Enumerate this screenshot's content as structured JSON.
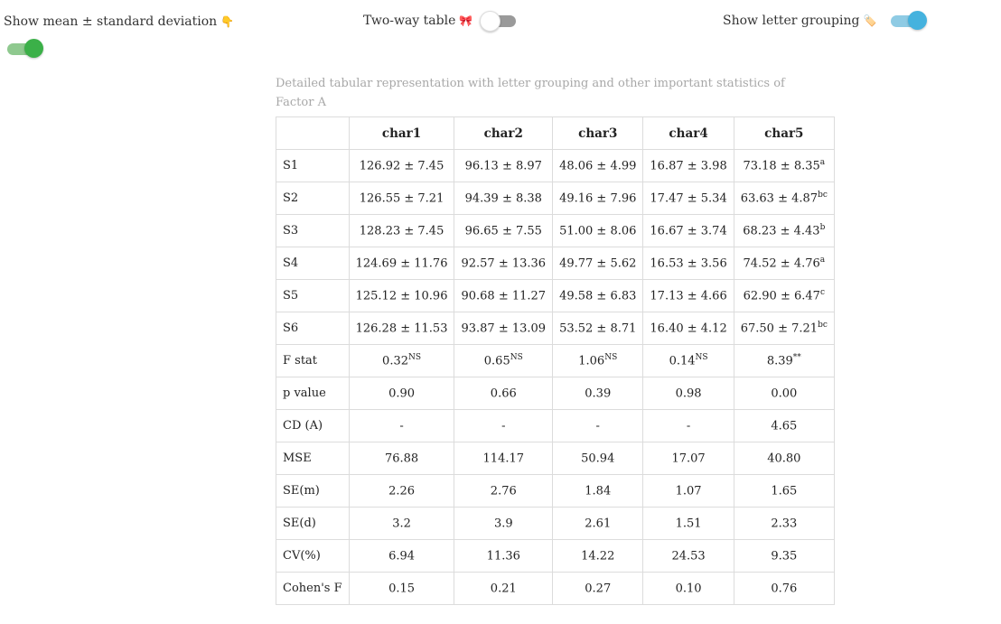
{
  "toggles": {
    "mean_sd": {
      "label": "Show mean ± standard deviation",
      "emoji": "👇",
      "state": "on",
      "color": "#3bb048"
    },
    "two_way": {
      "label": "Two-way table",
      "emoji": "🎀",
      "state": "off"
    },
    "letter_grouping": {
      "label": "Show letter grouping",
      "emoji": "🏷️",
      "state": "on",
      "color": "#45b2de"
    }
  },
  "caption": "Detailed tabular representation with letter grouping and other important statistics of Factor A",
  "table": {
    "headers": [
      "",
      "char1",
      "char2",
      "char3",
      "char4",
      "char5"
    ],
    "rows": [
      {
        "label": "S1",
        "cells": [
          [
            "126.92 ± 7.45",
            ""
          ],
          [
            "96.13 ± 8.97",
            ""
          ],
          [
            "48.06 ± 4.99",
            ""
          ],
          [
            "16.87 ± 3.98",
            ""
          ],
          [
            "73.18 ± 8.35",
            "a"
          ]
        ]
      },
      {
        "label": "S2",
        "cells": [
          [
            "126.55 ± 7.21",
            ""
          ],
          [
            "94.39 ± 8.38",
            ""
          ],
          [
            "49.16 ± 7.96",
            ""
          ],
          [
            "17.47 ± 5.34",
            ""
          ],
          [
            "63.63 ± 4.87",
            "bc"
          ]
        ]
      },
      {
        "label": "S3",
        "cells": [
          [
            "128.23 ± 7.45",
            ""
          ],
          [
            "96.65 ± 7.55",
            ""
          ],
          [
            "51.00 ± 8.06",
            ""
          ],
          [
            "16.67 ± 3.74",
            ""
          ],
          [
            "68.23 ± 4.43",
            "b"
          ]
        ]
      },
      {
        "label": "S4",
        "cells": [
          [
            "124.69 ± 11.76",
            ""
          ],
          [
            "92.57 ± 13.36",
            ""
          ],
          [
            "49.77 ± 5.62",
            ""
          ],
          [
            "16.53 ± 3.56",
            ""
          ],
          [
            "74.52 ± 4.76",
            "a"
          ]
        ]
      },
      {
        "label": "S5",
        "cells": [
          [
            "125.12 ± 10.96",
            ""
          ],
          [
            "90.68 ± 11.27",
            ""
          ],
          [
            "49.58 ± 6.83",
            ""
          ],
          [
            "17.13 ± 4.66",
            ""
          ],
          [
            "62.90 ± 6.47",
            "c"
          ]
        ]
      },
      {
        "label": "S6",
        "cells": [
          [
            "126.28 ± 11.53",
            ""
          ],
          [
            "93.87 ± 13.09",
            ""
          ],
          [
            "53.52 ± 8.71",
            ""
          ],
          [
            "16.40 ± 4.12",
            ""
          ],
          [
            "67.50 ± 7.21",
            "bc"
          ]
        ]
      },
      {
        "label": "F stat",
        "cells": [
          [
            "0.32",
            "NS"
          ],
          [
            "0.65",
            "NS"
          ],
          [
            "1.06",
            "NS"
          ],
          [
            "0.14",
            "NS"
          ],
          [
            "8.39",
            "**"
          ]
        ]
      },
      {
        "label": "p value",
        "cells": [
          [
            "0.90",
            ""
          ],
          [
            "0.66",
            ""
          ],
          [
            "0.39",
            ""
          ],
          [
            "0.98",
            ""
          ],
          [
            "0.00",
            ""
          ]
        ]
      },
      {
        "label": "CD (A)",
        "cells": [
          [
            "-",
            ""
          ],
          [
            "-",
            ""
          ],
          [
            "-",
            ""
          ],
          [
            "-",
            ""
          ],
          [
            "4.65",
            ""
          ]
        ]
      },
      {
        "label": "MSE",
        "cells": [
          [
            "76.88",
            ""
          ],
          [
            "114.17",
            ""
          ],
          [
            "50.94",
            ""
          ],
          [
            "17.07",
            ""
          ],
          [
            "40.80",
            ""
          ]
        ]
      },
      {
        "label": "SE(m)",
        "cells": [
          [
            "2.26",
            ""
          ],
          [
            "2.76",
            ""
          ],
          [
            "1.84",
            ""
          ],
          [
            "1.07",
            ""
          ],
          [
            "1.65",
            ""
          ]
        ]
      },
      {
        "label": "SE(d)",
        "cells": [
          [
            "3.2",
            ""
          ],
          [
            "3.9",
            ""
          ],
          [
            "2.61",
            ""
          ],
          [
            "1.51",
            ""
          ],
          [
            "2.33",
            ""
          ]
        ]
      },
      {
        "label": "CV(%)",
        "cells": [
          [
            "6.94",
            ""
          ],
          [
            "11.36",
            ""
          ],
          [
            "14.22",
            ""
          ],
          [
            "24.53",
            ""
          ],
          [
            "9.35",
            ""
          ]
        ]
      },
      {
        "label": "Cohen's F",
        "cells": [
          [
            "0.15",
            ""
          ],
          [
            "0.21",
            ""
          ],
          [
            "0.27",
            ""
          ],
          [
            "0.10",
            ""
          ],
          [
            "0.76",
            ""
          ]
        ]
      }
    ]
  }
}
